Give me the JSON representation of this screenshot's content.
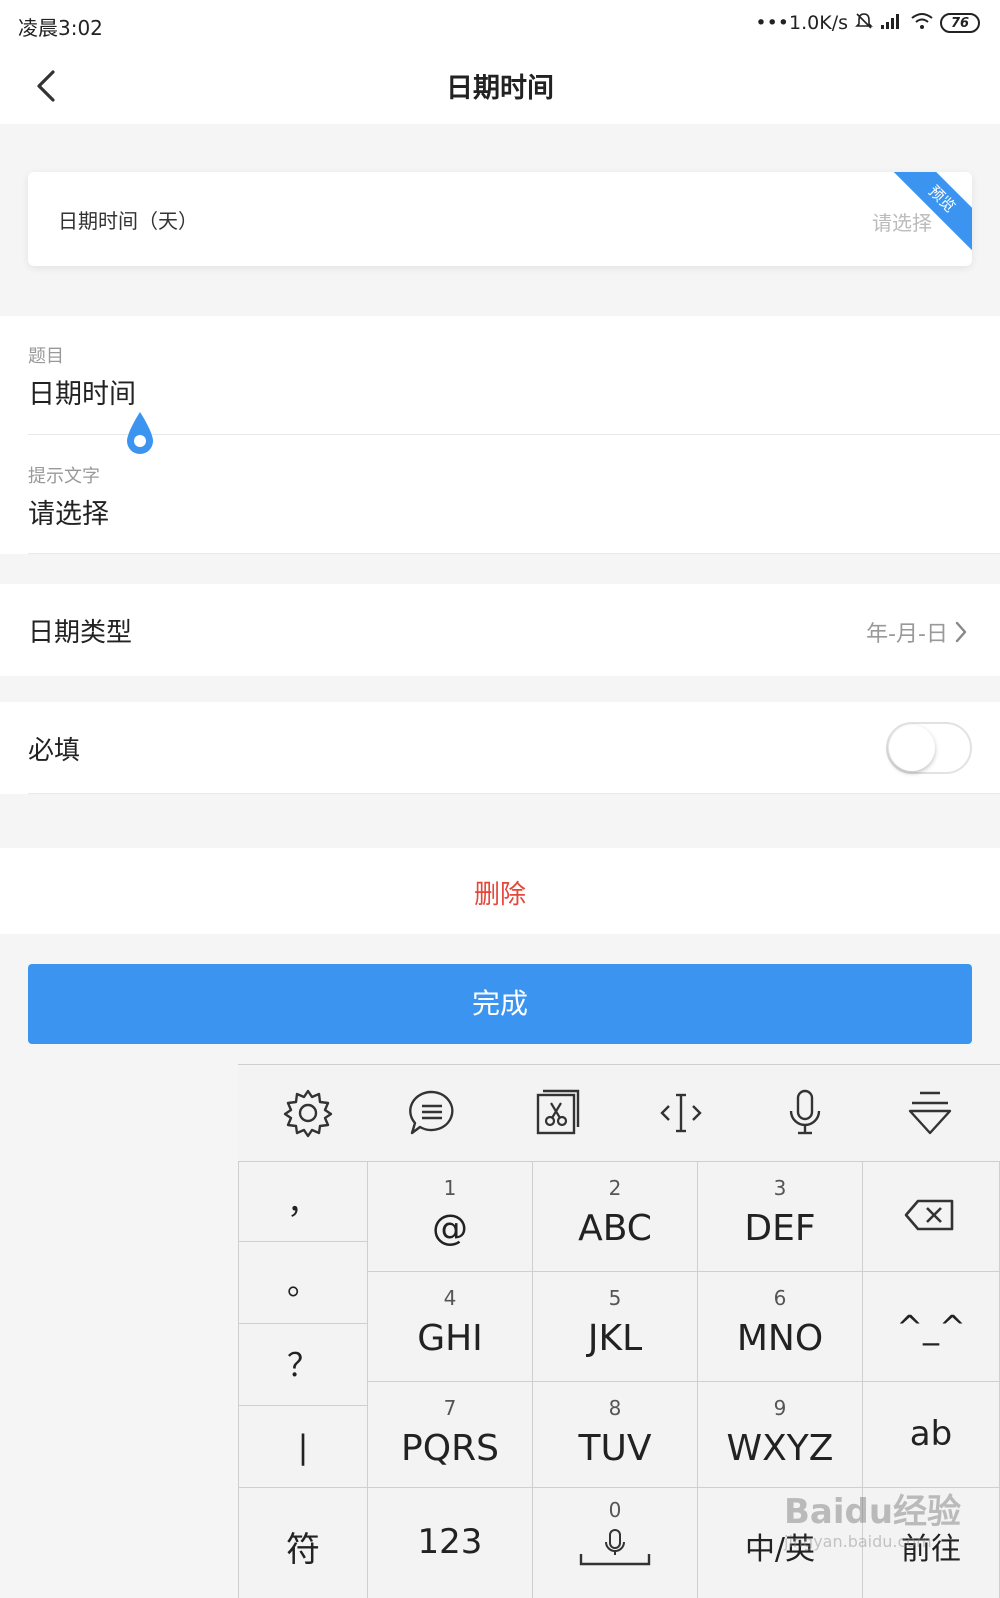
{
  "status_bar": {
    "time": "凌晨3:02",
    "network_speed": "•••1.0K/s",
    "battery": "76"
  },
  "nav": {
    "title": "日期时间"
  },
  "preview": {
    "label": "日期时间（天）",
    "placeholder": "请选择",
    "ribbon": "预览"
  },
  "form": {
    "title_caption": "题目",
    "title_value": "日期时间",
    "hint_caption": "提示文字",
    "hint_value": "请选择"
  },
  "date_type": {
    "label": "日期类型",
    "value": "年-月-日"
  },
  "required": {
    "label": "必填",
    "on": false
  },
  "delete_label": "删除",
  "done_label": "完成",
  "keyboard": {
    "side_keys": [
      "，",
      "。",
      "？",
      "|"
    ],
    "keys": [
      {
        "num": "1",
        "letters": "@"
      },
      {
        "num": "2",
        "letters": "ABC"
      },
      {
        "num": "3",
        "letters": "DEF"
      },
      {
        "num": "4",
        "letters": "GHI"
      },
      {
        "num": "5",
        "letters": "JKL"
      },
      {
        "num": "6",
        "letters": "MNO"
      },
      {
        "num": "7",
        "letters": "PQRS"
      },
      {
        "num": "8",
        "letters": "TUV"
      },
      {
        "num": "9",
        "letters": "WXYZ"
      }
    ],
    "emoticon": "^_^",
    "ab": "ab",
    "symbol": "符",
    "num123": "123",
    "zero": "0",
    "lang": "中/英",
    "go": "前往"
  },
  "colors": {
    "accent": "#3b95f0",
    "delete": "#e5473a"
  },
  "watermark": {
    "brand": "Baidu经验",
    "url": "jingyan.baidu.com"
  }
}
